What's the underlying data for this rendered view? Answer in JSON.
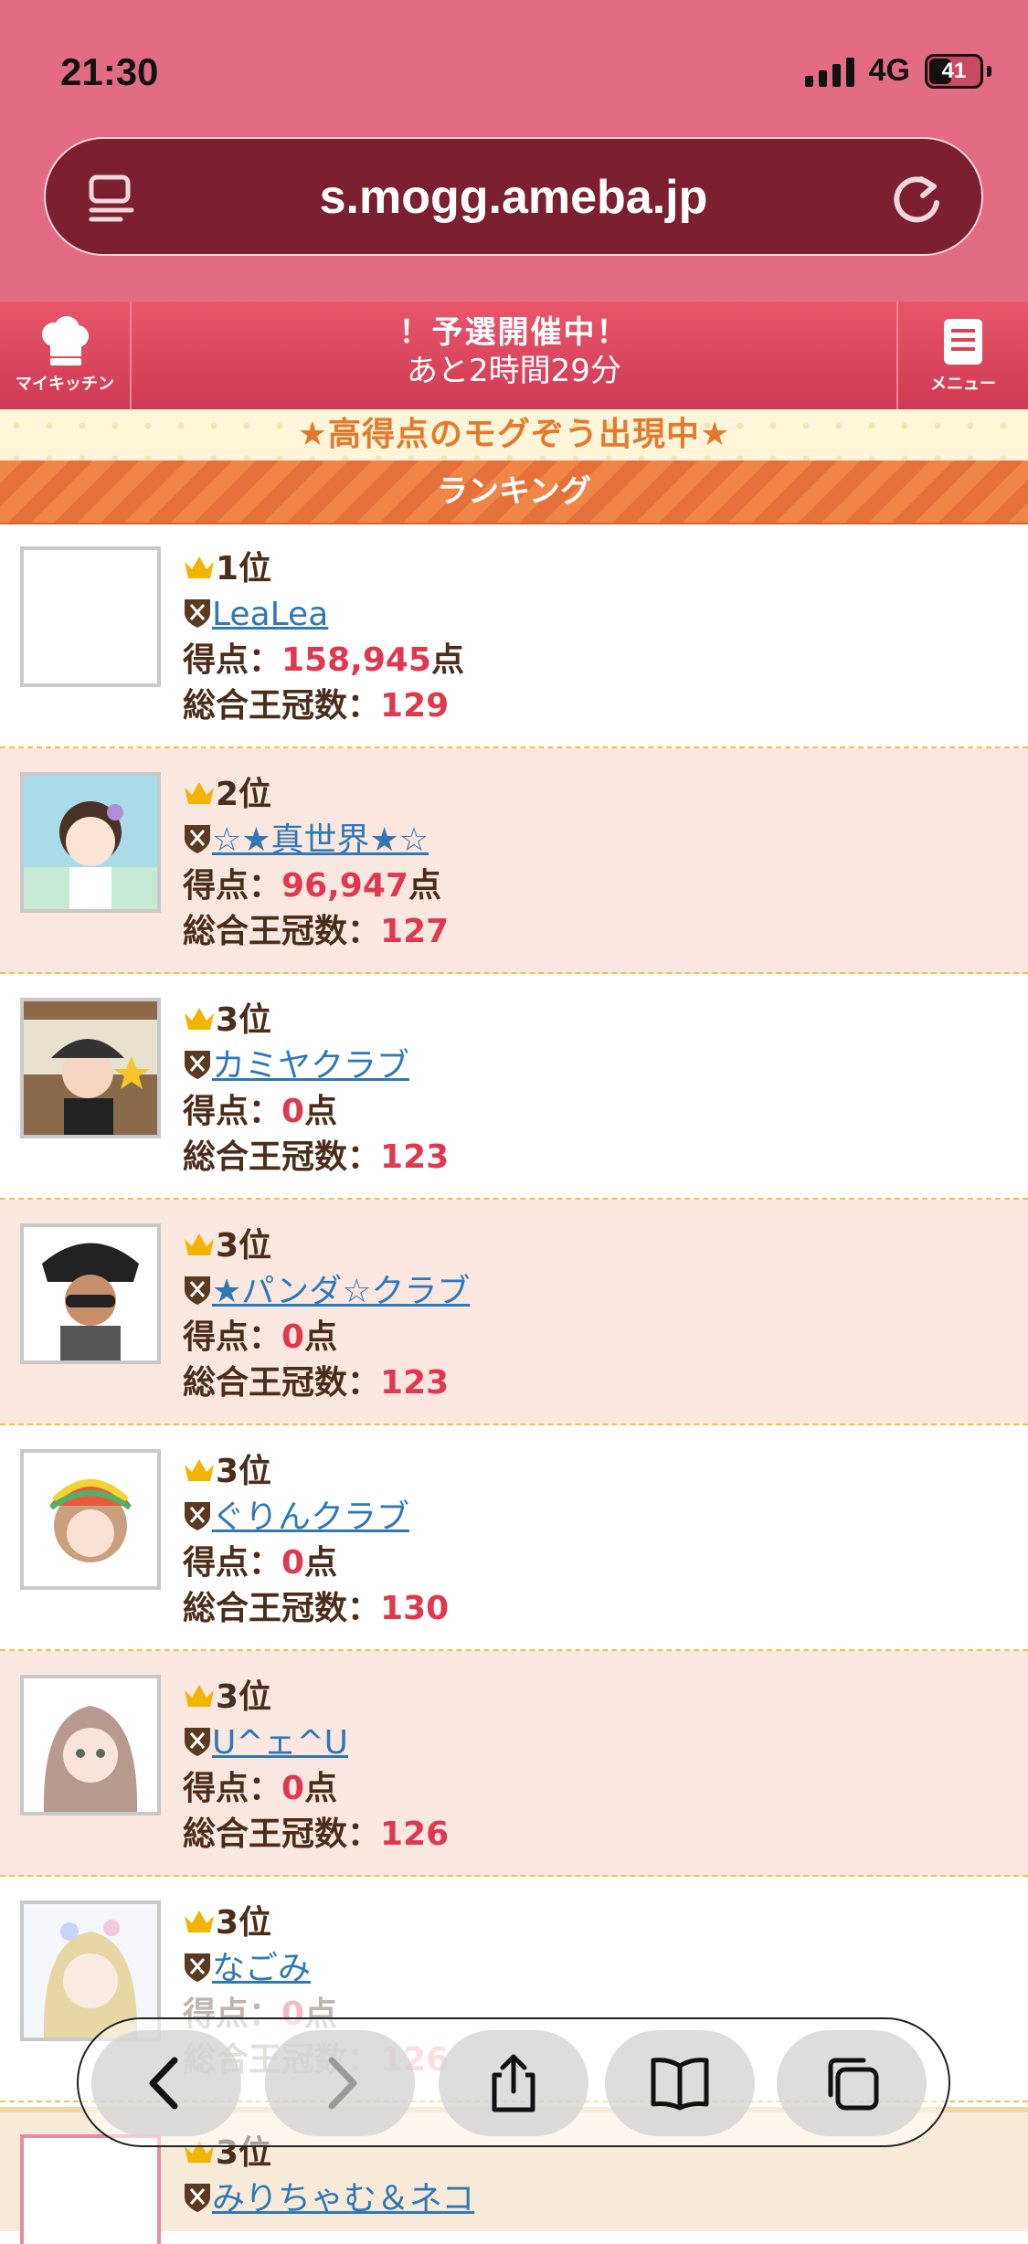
{
  "status": {
    "time": "21:30",
    "network": "4G",
    "battery": "41"
  },
  "browser": {
    "url": "s.mogg.ameba.jp"
  },
  "game": {
    "left_label": "マイキッチン",
    "title": "！予選開催中！",
    "subtitle": "あと2時間29分",
    "right_label": "メニュー",
    "banner": "★高得点のモグぞう出現中★",
    "section": "ランキング"
  },
  "labels": {
    "score": "得点：",
    "points_suffix": "点",
    "crowns": "総合王冠数："
  },
  "ranking": [
    {
      "rank": "1位",
      "name": "LeaLea",
      "score": "158,945",
      "crowns": "129"
    },
    {
      "rank": "2位",
      "name": "☆★真世界★☆",
      "score": "96,947",
      "crowns": "127"
    },
    {
      "rank": "3位",
      "name": "カミヤクラブ",
      "score": "0",
      "crowns": "123"
    },
    {
      "rank": "3位",
      "name": "★パンダ☆クラブ",
      "score": "0",
      "crowns": "123"
    },
    {
      "rank": "3位",
      "name": "ぐりんクラブ",
      "score": "0",
      "crowns": "130"
    },
    {
      "rank": "3位",
      "name": "U^ェ^U",
      "score": "0",
      "crowns": "126"
    },
    {
      "rank": "3位",
      "name": "なごみ",
      "score": "0",
      "crowns": "126"
    }
  ],
  "last_entry": {
    "rank": "3位",
    "name": "みりちゃむ＆ネコ"
  },
  "colors": {
    "header": "#e46b84",
    "url_pill": "#7b1f31",
    "game_bar": "#e9566c",
    "score": "#e0394f",
    "link": "#2f78b8",
    "alt_row": "#fae8e0"
  },
  "icons": [
    "page-menu-icon",
    "reload-icon",
    "chef-hat-icon",
    "menu-book-icon",
    "crown-icon",
    "shield-icon",
    "back-icon",
    "forward-icon",
    "share-icon",
    "bookmarks-icon",
    "tabs-icon"
  ]
}
